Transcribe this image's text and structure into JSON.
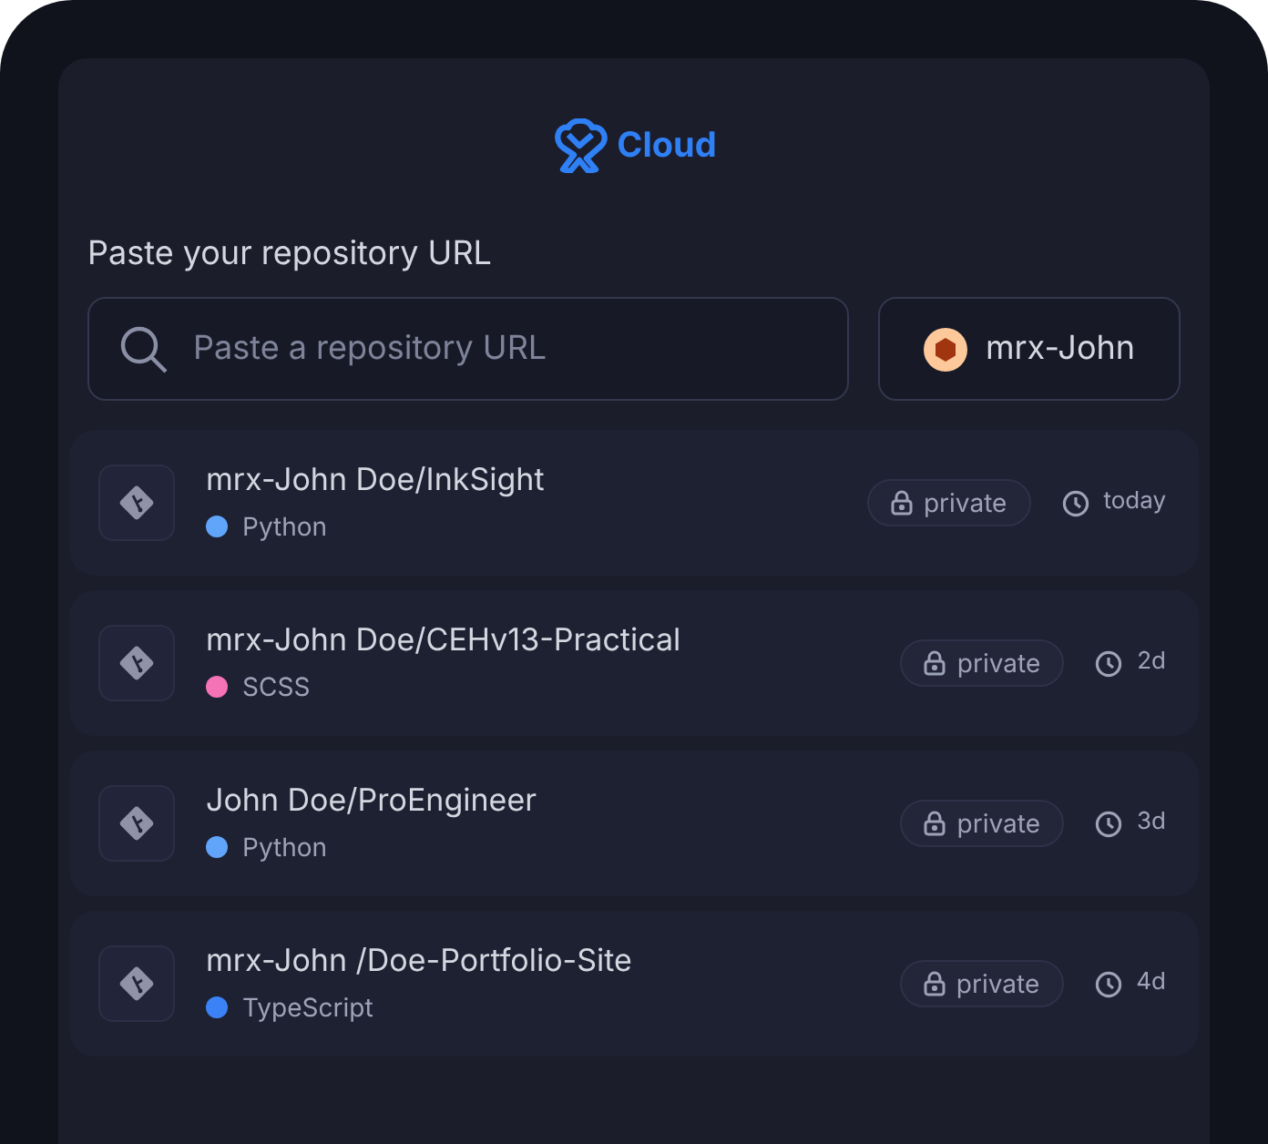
{
  "logo": {
    "text": "Cloud"
  },
  "prompt": "Paste your repository URL",
  "search": {
    "placeholder": "Paste a repository URL"
  },
  "account": {
    "name": "mrx-John"
  },
  "repos": [
    {
      "name": "mrx-John Doe/InkSight",
      "language": "Python",
      "color": "#60a5fa",
      "visibility": "private",
      "updated": "today"
    },
    {
      "name": "mrx-John Doe/CEHv13-Practical",
      "language": "SCSS",
      "color": "#f472b6",
      "visibility": "private",
      "updated": "2d"
    },
    {
      "name": "John Doe/ProEngineer",
      "language": "Python",
      "color": "#60a5fa",
      "visibility": "private",
      "updated": "3d"
    },
    {
      "name": "mrx-John /Doe-Portfolio-Site",
      "language": "TypeScript",
      "color": "#3b82f6",
      "visibility": "private",
      "updated": "4d"
    }
  ]
}
